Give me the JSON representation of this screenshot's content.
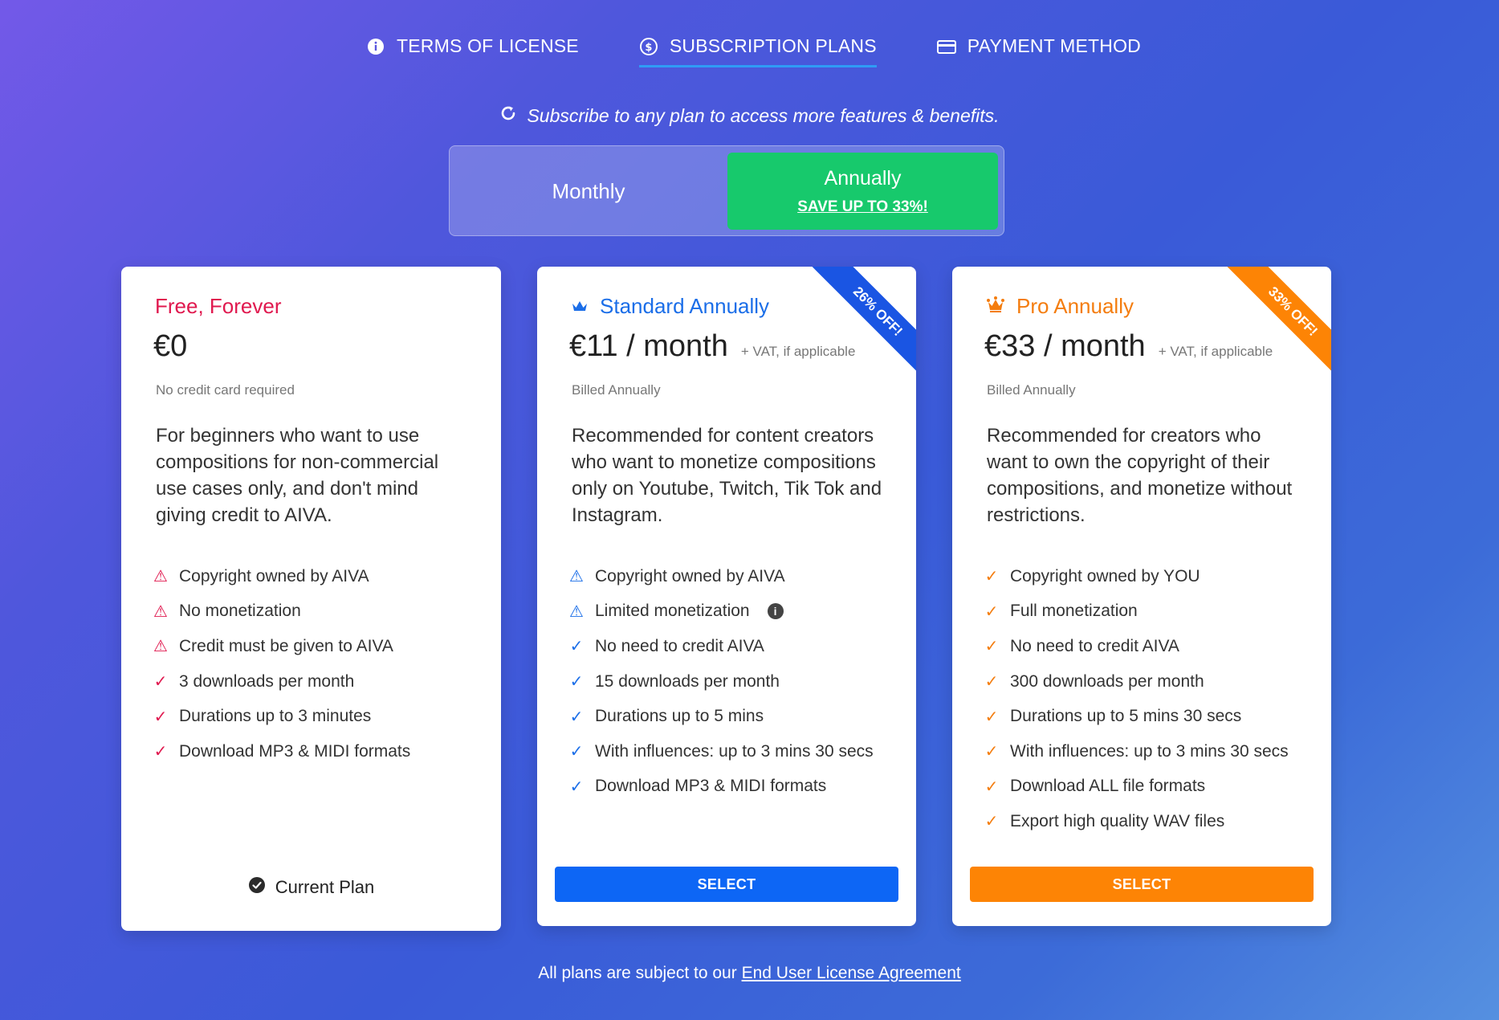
{
  "tabs": [
    {
      "label": "TERMS OF LICENSE",
      "icon": "info-circle-icon"
    },
    {
      "label": "SUBSCRIPTION PLANS",
      "icon": "dollar-circle-icon",
      "active": true
    },
    {
      "label": "PAYMENT METHOD",
      "icon": "credit-card-icon"
    }
  ],
  "subtitle": "Subscribe to any plan to access more features & benefits.",
  "billing_toggle": {
    "monthly": "Monthly",
    "annually": "Annually",
    "annually_promo": "SAVE UP TO 33%!",
    "selected": "Annually"
  },
  "colors": {
    "free_accent": "#e0194f",
    "standard_accent": "#1b6ee8",
    "pro_accent": "#f47d0f",
    "annual_green": "#17c96c"
  },
  "plans": {
    "free": {
      "name": "Free, Forever",
      "price": "€0",
      "billed": "No credit card required",
      "description": "For beginners who want to use compositions for non-commercial use cases only, and don't mind giving credit to AIVA.",
      "features": [
        "Copyright owned by AIVA",
        "No monetization",
        "Credit must be given to AIVA",
        "3 downloads per month",
        "Durations up to 3 minutes",
        "Download MP3 & MIDI formats"
      ],
      "status": "Current Plan"
    },
    "standard": {
      "name": "Standard Annually",
      "ribbon": "26% OFF!",
      "price": "€11 / month",
      "vat": "+ VAT, if applicable",
      "billed": "Billed Annually",
      "description": "Recommended for content creators who want to monetize compositions only on Youtube, Twitch, Tik Tok and Instagram.",
      "features": [
        "Copyright owned by AIVA",
        "Limited monetization",
        "No need to credit AIVA",
        "15 downloads per month",
        "Durations up to 5 mins",
        "With influences: up to 3 mins 30 secs",
        "Download MP3 & MIDI formats"
      ],
      "button": "SELECT"
    },
    "pro": {
      "name": "Pro Annually",
      "ribbon": "33% OFF!",
      "price": "€33 / month",
      "vat": "+ VAT, if applicable",
      "billed": "Billed Annually",
      "description": "Recommended for creators who want to own the copyright of their compositions, and monetize without restrictions.",
      "features": [
        "Copyright owned by YOU",
        "Full monetization",
        "No need to credit AIVA",
        "300 downloads per month",
        "Durations up to 5 mins 30 secs",
        "With influences: up to 3 mins 30 secs",
        "Download ALL file formats",
        "Export high quality WAV files"
      ],
      "button": "SELECT"
    }
  },
  "footer": {
    "text": "All plans are subject to our",
    "link": "End User License Agreement"
  }
}
